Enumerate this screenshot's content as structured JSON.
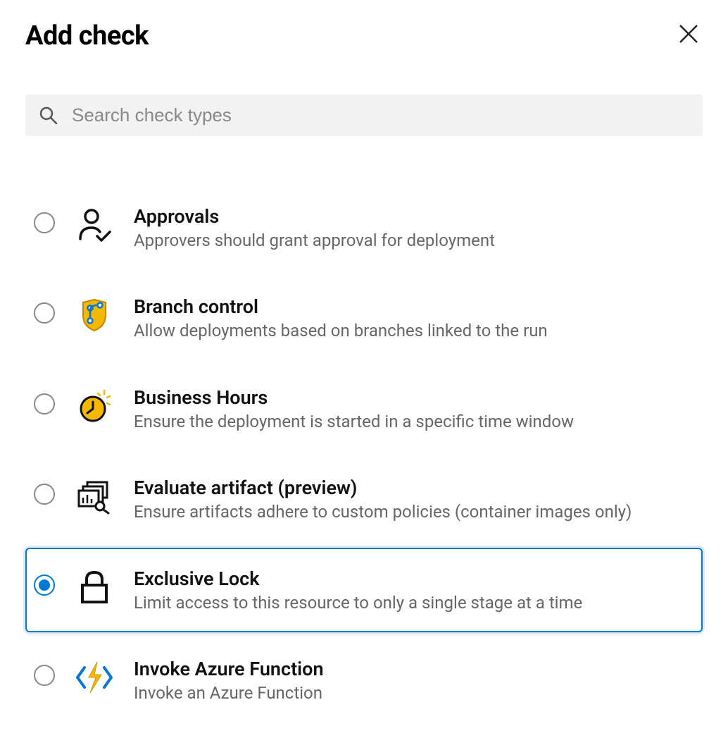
{
  "header": {
    "title": "Add check"
  },
  "search": {
    "placeholder": "Search check types"
  },
  "checks": [
    {
      "id": "approvals",
      "title": "Approvals",
      "desc": "Approvers should grant approval for deployment",
      "icon": "user-check-icon",
      "selected": false
    },
    {
      "id": "branch-control",
      "title": "Branch control",
      "desc": "Allow deployments based on branches linked to the run",
      "icon": "branch-shield-icon",
      "selected": false
    },
    {
      "id": "business-hours",
      "title": "Business Hours",
      "desc": "Ensure the deployment is started in a specific time window",
      "icon": "clock-sun-icon",
      "selected": false
    },
    {
      "id": "evaluate-artifact",
      "title": "Evaluate artifact (preview)",
      "desc": "Ensure artifacts adhere to custom policies (container images only)",
      "icon": "artifact-icon",
      "selected": false
    },
    {
      "id": "exclusive-lock",
      "title": "Exclusive Lock",
      "desc": "Limit access to this resource to only a single stage at a time",
      "icon": "lock-icon",
      "selected": true
    },
    {
      "id": "invoke-azure-function",
      "title": "Invoke Azure Function",
      "desc": "Invoke an Azure Function",
      "icon": "azure-function-icon",
      "selected": false
    }
  ]
}
